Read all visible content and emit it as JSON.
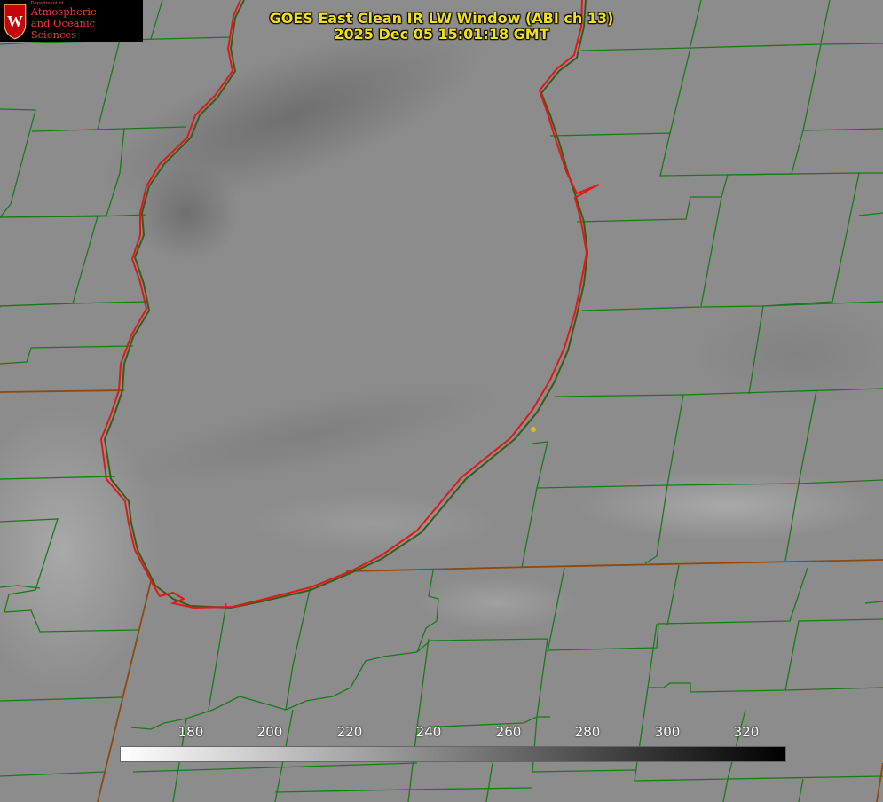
{
  "title": {
    "line1": "GOES East Clean IR LW Window (ABI ch 13)",
    "line2": "2025 Dec 05 15:01:18 GMT"
  },
  "logo": {
    "dept": "Department of",
    "line1": "Atmospheric",
    "line2": "and Oceanic Sciences",
    "crest_letter": "W",
    "colors": {
      "crest": "#c5050c",
      "text": "#e63a3a"
    }
  },
  "colorbar": {
    "ticks": [
      "180",
      "200",
      "220",
      "240",
      "260",
      "280",
      "300",
      "320"
    ],
    "gradient": [
      "#ffffff",
      "#000000"
    ]
  },
  "map": {
    "lake_shoreline_color": "#e01818",
    "boundary_color": "#1a7a1a",
    "state_border_color": "#8a4a10",
    "marker_color": "#d8c020"
  }
}
